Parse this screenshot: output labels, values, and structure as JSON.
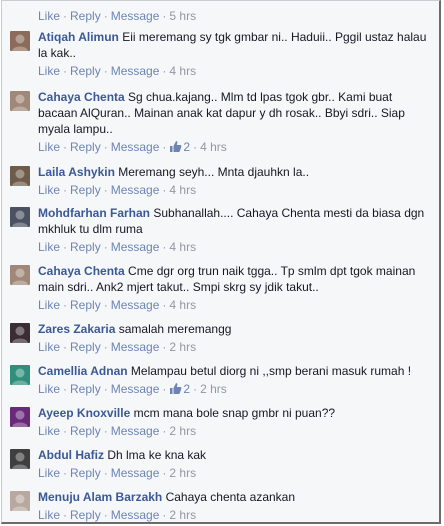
{
  "top_actions": {
    "like": "Like",
    "reply": "Reply",
    "message": "Message",
    "time": "5 hrs"
  },
  "comments": [
    {
      "author": "Atiqah Alimun",
      "text": "Eii meremang sy tgk gmbar ni.. Haduii.. Pggil ustaz halau la kak..",
      "like": "Like",
      "reply": "Reply",
      "message": "Message",
      "likes": "",
      "time": "4 hrs",
      "avatar_color": "#8b6b5a"
    },
    {
      "author": "Cahaya Chenta",
      "text": "Sg chua.kajang.. Mlm td lpas tgok gbr.. Kami buat bacaan AlQuran.. Mainan anak kat dapur y dh rosak.. Bbyi sdri.. Siap myala lampu..",
      "like": "Like",
      "reply": "Reply",
      "message": "Message",
      "likes": "2",
      "time": "4 hrs",
      "avatar_color": "#a08878"
    },
    {
      "author": "Laila Ashykin",
      "text": "Meremang seyh... Mnta djauhkn la..",
      "like": "Like",
      "reply": "Reply",
      "message": "Message",
      "likes": "",
      "time": "4 hrs",
      "avatar_color": "#6e5b4a"
    },
    {
      "author": "Mohdfarhan Farhan",
      "text": "Subhanallah.... Cahaya Chenta mesti da biasa dgn mkhluk tu dlm ruma",
      "like": "Like",
      "reply": "Reply",
      "message": "Message",
      "likes": "",
      "time": "4 hrs",
      "avatar_color": "#4a5160"
    },
    {
      "author": "Cahaya Chenta",
      "text": "Cme dgr org trun naik tgga.. Tp smlm dpt tgok mainan main sdri.. Ank2 mjert takut.. Smpi skrg sy jdik takut..",
      "like": "Like",
      "reply": "Reply",
      "message": "Message",
      "likes": "",
      "time": "4 hrs",
      "avatar_color": "#a08878"
    },
    {
      "author": "Zares Zakaria",
      "text": "samalah meremangg",
      "like": "Like",
      "reply": "Reply",
      "message": "Message",
      "likes": "",
      "time": "2 hrs",
      "avatar_color": "#3a2d33"
    },
    {
      "author": "Camellia Adnan",
      "text": "Melampau betul diorg ni ,,smp berani masuk rumah !",
      "like": "Like",
      "reply": "Reply",
      "message": "Message",
      "likes": "2",
      "time": "2 hrs",
      "avatar_color": "#2f8f7a"
    },
    {
      "author": "Ayeep Knoxville",
      "text": "mcm mana bole snap gmbr ni puan??",
      "like": "Like",
      "reply": "Reply",
      "message": "Message",
      "likes": "",
      "time": "2 hrs",
      "avatar_color": "#6a2a7a"
    },
    {
      "author": "Abdul Hafiz",
      "text": "Dh lma ke kna kak",
      "like": "Like",
      "reply": "Reply",
      "message": "Message",
      "likes": "",
      "time": "2 hrs",
      "avatar_color": "#3f3f3f"
    },
    {
      "author": "Menuju Alam Barzakh",
      "text": "Cahaya chenta azankan",
      "like": "Like",
      "reply": "Reply",
      "message": "Message",
      "likes": "",
      "time": "2 hrs",
      "avatar_color": "#b8a9a0"
    }
  ]
}
